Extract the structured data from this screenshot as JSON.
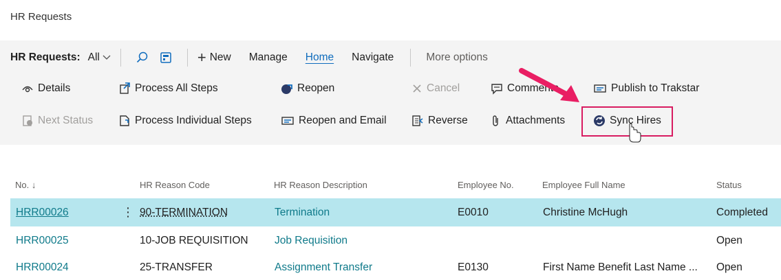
{
  "page": {
    "title": "HR Requests"
  },
  "actionbar": {
    "label": "HR Requests:",
    "view": "All",
    "menu": [
      {
        "label": "New"
      },
      {
        "label": "Manage"
      },
      {
        "label": "Home"
      },
      {
        "label": "Navigate"
      }
    ],
    "more": "More options"
  },
  "actions": {
    "row1": [
      "Details",
      "Process All Steps",
      "Reopen",
      "Cancel",
      "Comments",
      "Publish to Trakstar"
    ],
    "row2": [
      "Next Status",
      "Process Individual Steps",
      "Reopen and Email",
      "Reverse",
      "Attachments",
      "Sync Hires"
    ]
  },
  "table": {
    "columns": [
      "No. ↓",
      "HR Reason Code",
      "HR Reason Description",
      "Employee No.",
      "Employee Full Name",
      "Status"
    ],
    "rows": [
      {
        "no": "HRR00026",
        "code": "90-TERMINATION",
        "desc": "Termination",
        "emp": "E0010",
        "name": "Christine McHugh",
        "status": "Completed"
      },
      {
        "no": "HRR00025",
        "code": "10-JOB REQUISITION",
        "desc": "Job Requisition",
        "emp": "",
        "name": "",
        "status": "Open"
      },
      {
        "no": "HRR00024",
        "code": "25-TRANSFER",
        "desc": "Assignment Transfer",
        "emp": "E0130",
        "name": "First Name Benefit Last Name ...",
        "status": "Open"
      }
    ]
  },
  "colors": {
    "accent": "#0f6cbd",
    "link": "#0f7a8a",
    "selected_row": "#b6e6ee",
    "highlight": "#d81b60"
  }
}
